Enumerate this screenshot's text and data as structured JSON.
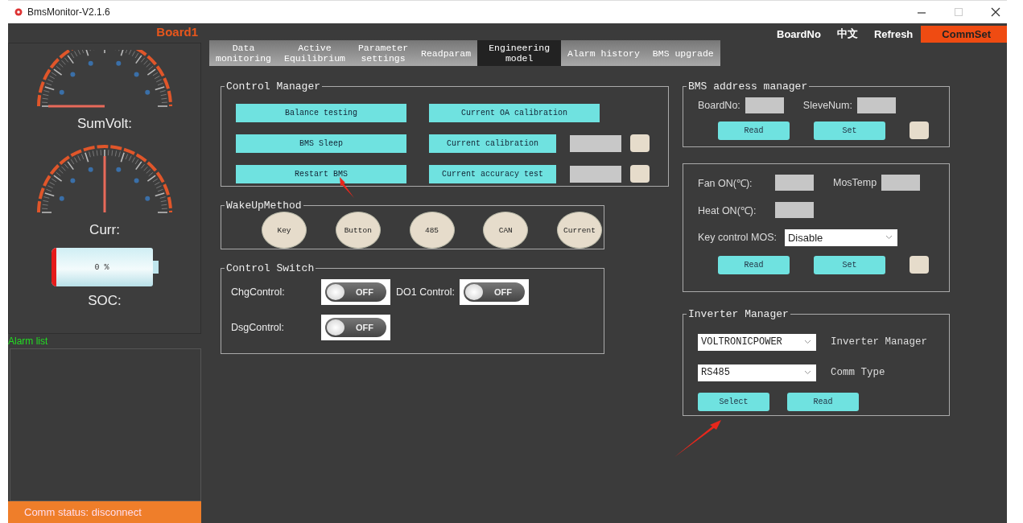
{
  "window": {
    "title": "BmsMonitor-V2.1.6"
  },
  "left_panel": {
    "board_label": "Board1",
    "gauges": [
      {
        "label": "SumVolt:"
      },
      {
        "label": "Curr:"
      }
    ],
    "battery": {
      "reading": "0 %"
    },
    "soc_label": "SOC:",
    "alarm_list_label": "Alarm list",
    "comm_status": "Comm status: disconnect"
  },
  "top_bar": [
    {
      "label": "BoardNo",
      "selected": false
    },
    {
      "label": "中文",
      "selected": false
    },
    {
      "label": "Refresh",
      "selected": false
    },
    {
      "label": "CommSet",
      "selected": true
    }
  ],
  "tabs": [
    {
      "label": "Data\nmonitoring",
      "selected": false
    },
    {
      "label": "Active\nEquilibrium",
      "selected": false
    },
    {
      "label": "Parameter\nsettings",
      "selected": false
    },
    {
      "label": "Readparam",
      "selected": false
    },
    {
      "label": "Engineering\nmodel",
      "selected": true
    },
    {
      "label": "Alarm history",
      "selected": false
    },
    {
      "label": "BMS upgrade",
      "selected": false
    }
  ],
  "control_manager": {
    "title": "Control Manager",
    "rows": [
      {
        "items": [
          {
            "kind": "button",
            "label": "Balance testing"
          },
          {
            "kind": "button",
            "label": "Current OA calibration"
          }
        ]
      },
      {
        "items": [
          {
            "kind": "button",
            "label": "BMS Sleep"
          },
          {
            "kind": "button",
            "label": "Current calibration"
          },
          {
            "kind": "field"
          },
          {
            "kind": "indicator"
          }
        ]
      },
      {
        "items": [
          {
            "kind": "button",
            "label": "Restart BMS"
          },
          {
            "kind": "button",
            "label": "Current accuracy test"
          },
          {
            "kind": "field"
          },
          {
            "kind": "indicator"
          }
        ]
      }
    ]
  },
  "wakeup_method": {
    "title": "WakeUpMethod",
    "options": [
      "Key",
      "Button",
      "485",
      "CAN",
      "Current"
    ]
  },
  "control_switch": {
    "title": "Control Switch",
    "switches": [
      {
        "label": "ChgControl:",
        "on": false,
        "text": "OFF"
      },
      {
        "label": "DO1 Control:",
        "on": false,
        "text": "OFF"
      },
      {
        "label": "DsgControl:",
        "on": false,
        "text": "OFF"
      }
    ]
  },
  "bms_address_manager": {
    "title": "BMS address manager",
    "fields": [
      {
        "label": "BoardNo:"
      },
      {
        "label": "SleveNum:"
      }
    ],
    "buttons": [
      "Read",
      "Set"
    ]
  },
  "temperature": {
    "fields": [
      {
        "label": "Fan ON(℃):"
      },
      {
        "label": "MosTemp"
      },
      {
        "label": "Heat ON(℃):"
      }
    ],
    "key_control": {
      "label": "Key control MOS:",
      "value": "Disable"
    },
    "buttons": [
      "Read",
      "Set"
    ]
  },
  "inverter_manager": {
    "title": "Inverter Manager",
    "selects": [
      {
        "value": "VOLTRONICPOWER",
        "label": "Inverter Manager"
      },
      {
        "value": "RS485",
        "label": "Comm Type"
      }
    ],
    "buttons": [
      "Select",
      "Read"
    ]
  }
}
